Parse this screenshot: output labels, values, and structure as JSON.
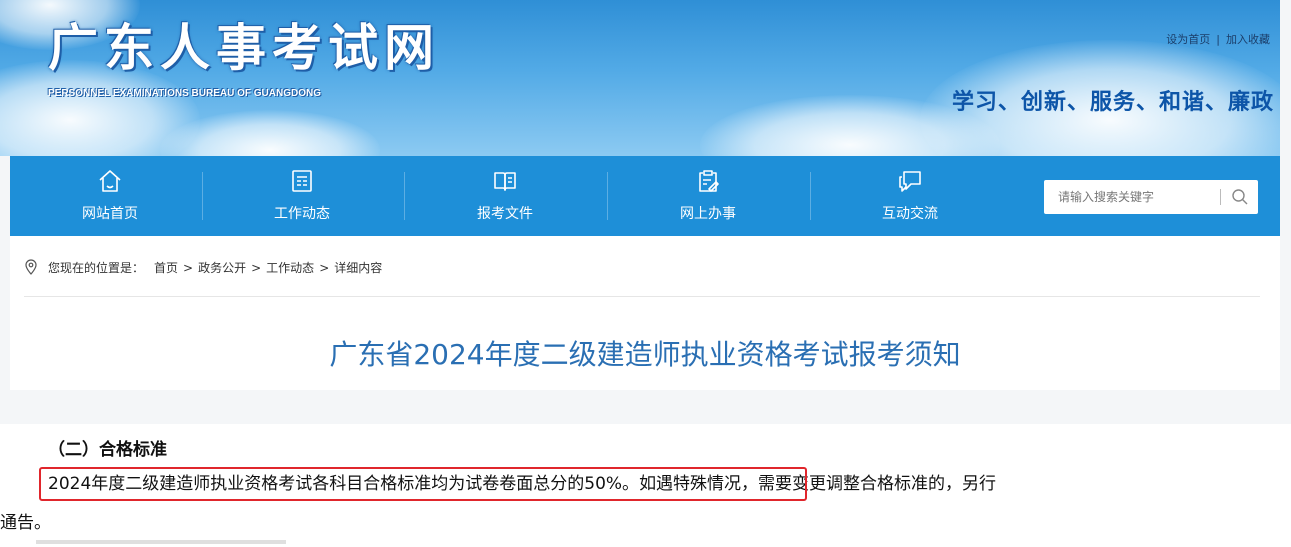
{
  "header": {
    "site_title": "广东人事考试网",
    "site_subtitle": "PERSONNEL EXAMINATIONS BUREAU OF GUANGDONG",
    "top_links": {
      "set_home": "设为首页",
      "separator": "|",
      "add_favorite": "加入收藏"
    },
    "slogan": "学习、创新、服务、和谐、廉政"
  },
  "nav": {
    "items": [
      {
        "label": "网站首页",
        "icon": "home-icon"
      },
      {
        "label": "工作动态",
        "icon": "news-icon"
      },
      {
        "label": "报考文件",
        "icon": "book-icon"
      },
      {
        "label": "网上办事",
        "icon": "clipboard-edit-icon"
      },
      {
        "label": "互动交流",
        "icon": "chat-bubble-icon"
      }
    ],
    "search": {
      "placeholder": "请输入搜索关键字",
      "icon": "search-icon"
    }
  },
  "breadcrumb": {
    "label": "您现在的位置是：",
    "items": [
      "首页",
      "政务公开",
      "工作动态",
      "详细内容"
    ],
    "separator": ">"
  },
  "article": {
    "title": "广东省2024年度二级建造师执业资格考试报考须知"
  },
  "excerpt": {
    "section_heading": "（二）合格标准",
    "highlighted_sentence": "2024年度二级建造师执业资格考试各科目合格标准均为试卷卷面总分的50%。",
    "continued_text": "如遇特殊情况，需要变更调整合格标准的，另行",
    "line2": "通告。"
  },
  "colors": {
    "nav_bg": "#1e8fd8",
    "title_blue": "#2a6fb3",
    "slogan_blue": "#0d55a8",
    "highlight_red": "#e0262c"
  }
}
